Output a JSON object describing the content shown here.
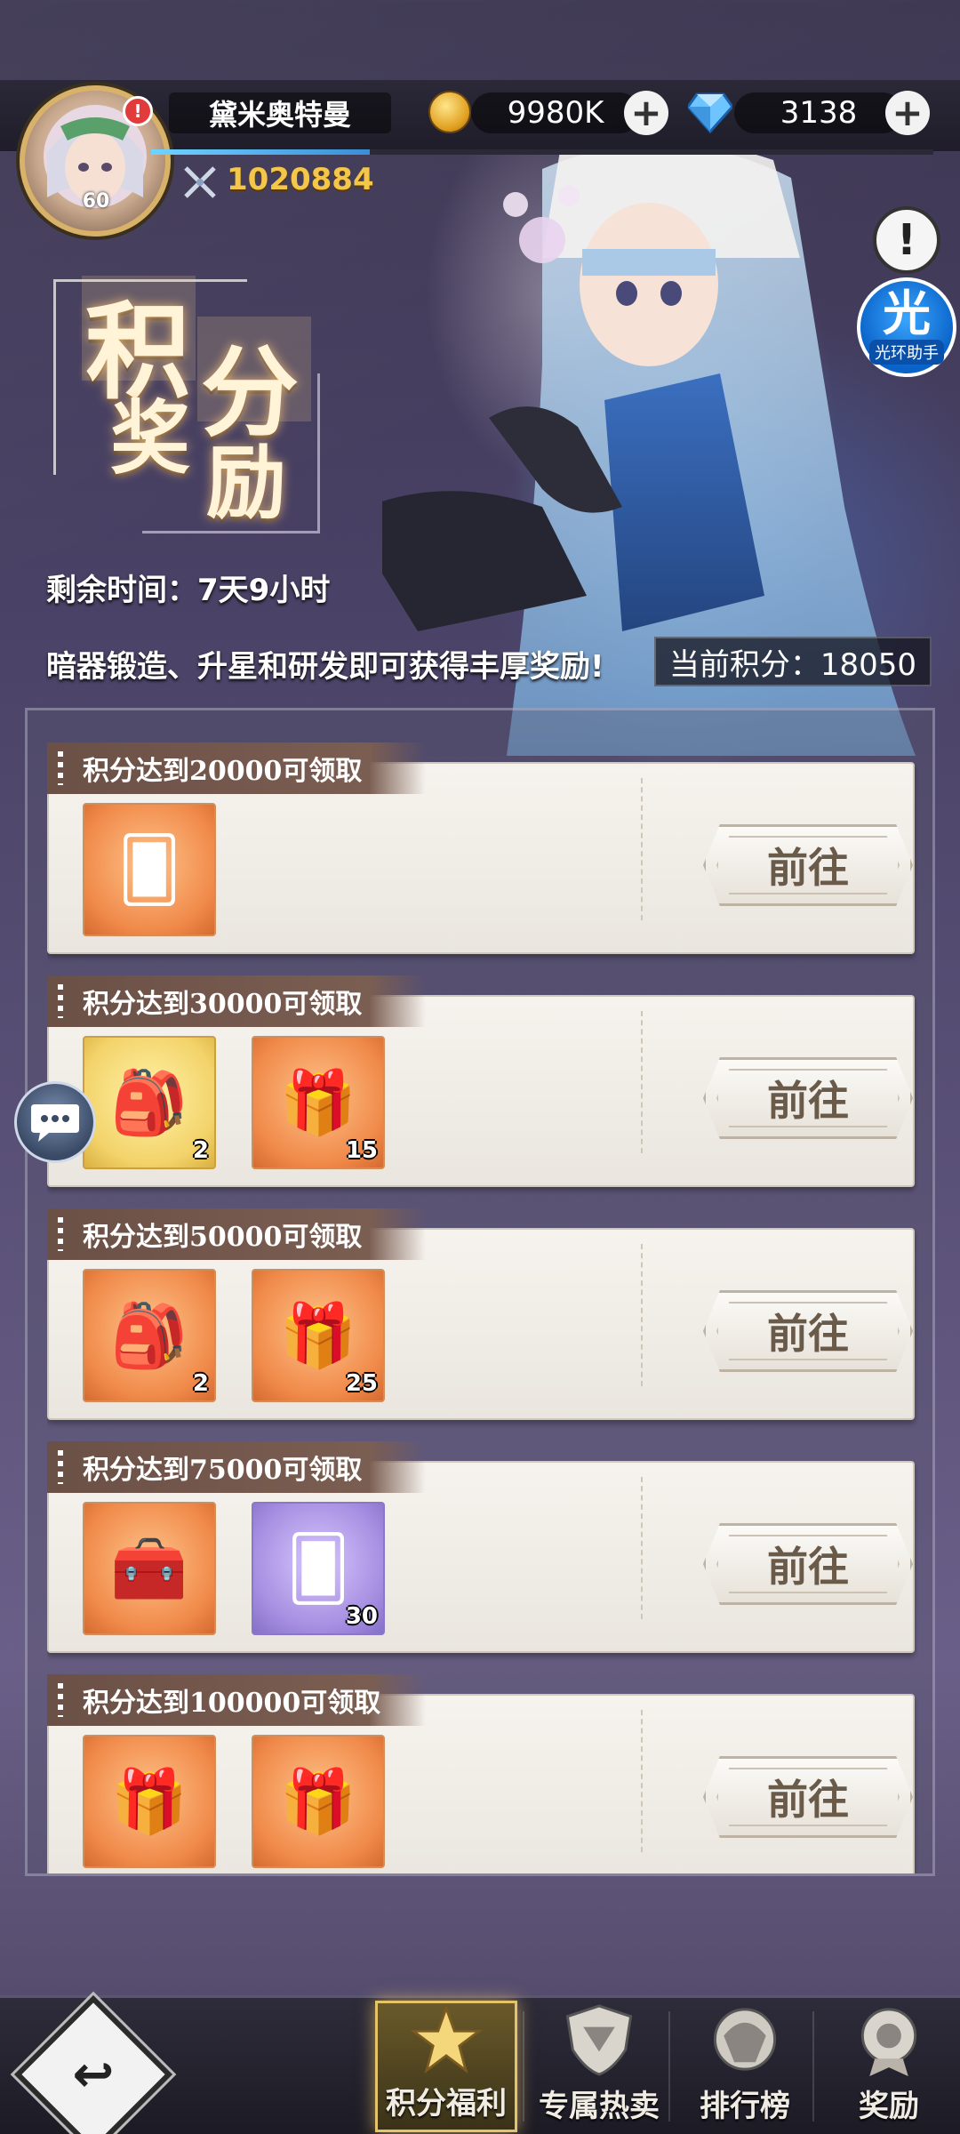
{
  "header": {
    "username": "黛米奥特曼",
    "level": "60",
    "alert_mark": "!",
    "gold_amount": "9980K",
    "diamond_amount": "3138",
    "combat_power": "1020884",
    "info_mark": "!",
    "assistant_glyph": "光",
    "assistant_label": "光环助手",
    "exp_progress": 0.28
  },
  "event": {
    "title_chars": [
      "积",
      "分",
      "奖",
      "励"
    ],
    "remaining_time": "剩余时间：7天9小时",
    "tip": "暗器锻造、升星和研发即可获得丰厚奖励!",
    "current_score": "当前积分：18050"
  },
  "rewards": [
    {
      "title": "积分达到20000可领取",
      "button": "前往",
      "items": [
        {
          "icon": "card-pack-icon",
          "bg": "orange",
          "count": ""
        }
      ]
    },
    {
      "title": "积分达到30000可领取",
      "button": "前往",
      "items": [
        {
          "icon": "mystery-bag-icon",
          "bg": "gold",
          "count": "2"
        },
        {
          "icon": "red-gift-bag-icon",
          "bg": "orange",
          "count": "15"
        }
      ]
    },
    {
      "title": "积分达到50000可领取",
      "button": "前往",
      "items": [
        {
          "icon": "mystery-bag-icon",
          "bg": "orange",
          "count": "2"
        },
        {
          "icon": "red-gift-bag-icon",
          "bg": "orange",
          "count": "25"
        }
      ]
    },
    {
      "title": "积分达到75000可领取",
      "button": "前往",
      "items": [
        {
          "icon": "treasure-chest-icon",
          "bg": "orange",
          "count": ""
        },
        {
          "icon": "card-pack-icon",
          "bg": "purple",
          "count": "30"
        }
      ]
    },
    {
      "title": "积分达到100000可领取",
      "button": "前往",
      "items": [
        {
          "icon": "red-gift-bag-icon",
          "bg": "orange",
          "count": ""
        },
        {
          "icon": "red-gift-bag-icon",
          "bg": "orange",
          "count": ""
        }
      ]
    }
  ],
  "nav": {
    "back_glyph": "↩",
    "tabs": [
      {
        "label": "积分福利",
        "icon": "star-emblem-icon",
        "active": true
      },
      {
        "label": "专属热卖",
        "icon": "shield-emblem-icon",
        "active": false
      },
      {
        "label": "排行榜",
        "icon": "crest-emblem-icon",
        "active": false
      },
      {
        "label": "奖励",
        "icon": "medal-emblem-icon",
        "active": false
      }
    ]
  },
  "colors": {
    "accent_gold": "#f4c64a",
    "card_title_bg": "#6b5046",
    "button_text": "#6a5a4a"
  }
}
